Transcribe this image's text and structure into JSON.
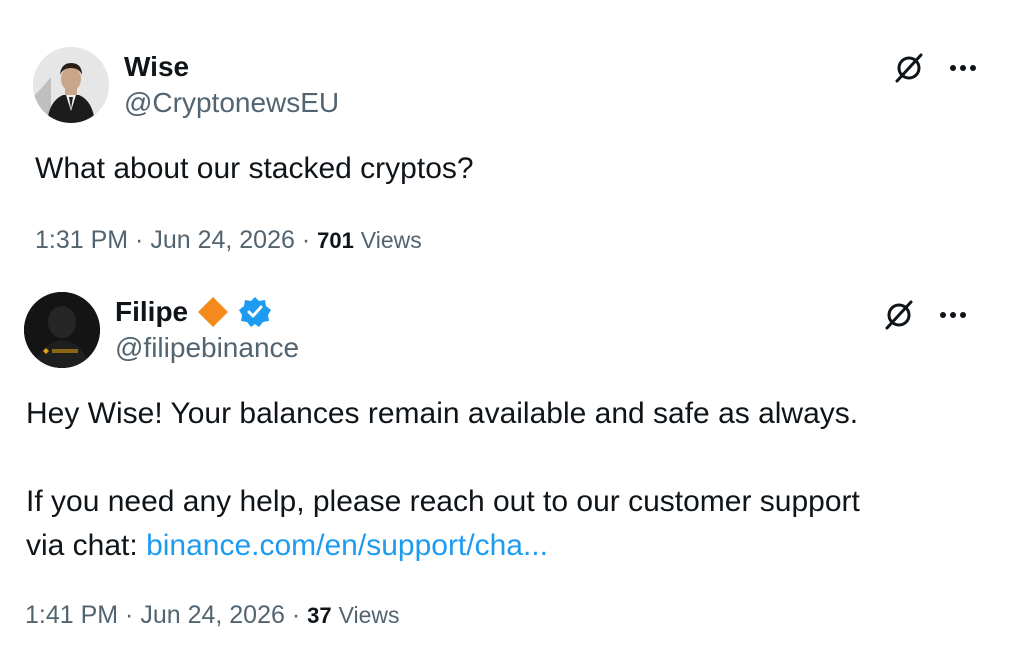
{
  "tweets": [
    {
      "author_name": "Wise",
      "handle": "@CryptonewsEU",
      "text": "What about our stacked cryptos?",
      "time": "1:31 PM",
      "date": "Jun 24, 2026",
      "views_count": "701",
      "views_label": "Views",
      "avatar_icon": "person-in-suit-avatar"
    },
    {
      "author_name": "Filipe",
      "handle": "@filipebinance",
      "paragraph1": "Hey Wise! Your balances remain available and safe as always.",
      "paragraph2_prefix": "If you need any help, please reach out to our customer support\nvia chat: ",
      "link_text": "binance.com/en/support/cha...",
      "time": "1:41 PM",
      "date": "Jun 24, 2026",
      "views_count": "37",
      "views_label": "Views",
      "avatar_icon": "binance-avatar",
      "badges": [
        "orange-diamond-badge",
        "blue-verified-badge"
      ]
    }
  ],
  "separator": " · ",
  "colors": {
    "text": "#0f1419",
    "secondary": "#536471",
    "link": "#1d9bf0",
    "verified": "#1d9bf0",
    "diamond": "#f48a1b"
  },
  "icons": {
    "grok": "grok-icon",
    "more": "more-icon"
  }
}
